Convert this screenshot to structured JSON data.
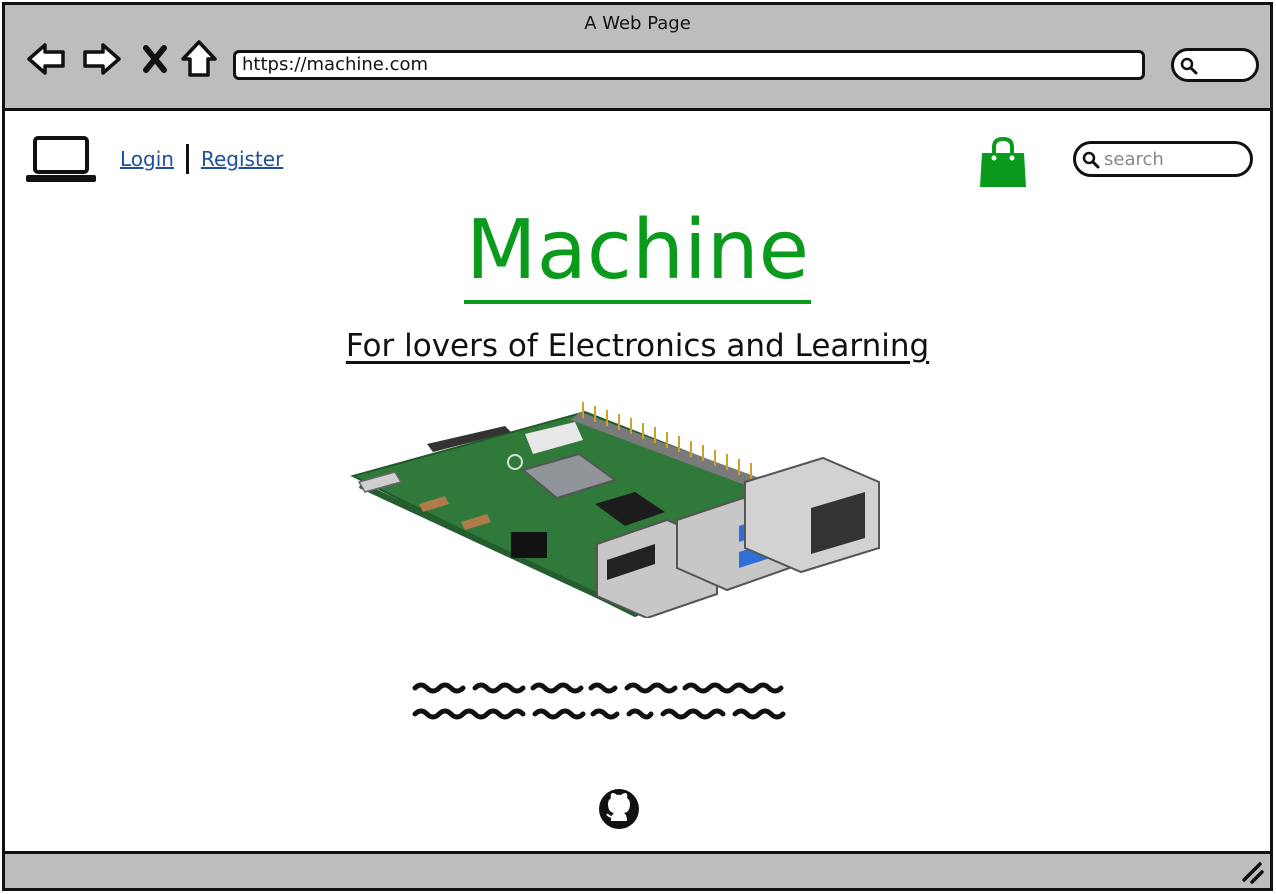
{
  "window": {
    "title": "A Web Page",
    "url": "https://machine.com"
  },
  "header": {
    "login_label": "Login",
    "register_label": "Register",
    "search_placeholder": "search"
  },
  "hero": {
    "title": "Machine",
    "tagline": "For lovers of Electronics and Learning"
  },
  "icons": {
    "back": "back-arrow-icon",
    "forward": "forward-arrow-icon",
    "stop": "close-icon",
    "home": "home-icon",
    "laptop": "laptop-icon",
    "bag": "shopping-bag-icon",
    "search": "search-icon",
    "github": "github-icon",
    "board": "raspberry-pi-board-image"
  },
  "colors": {
    "brand_green": "#0a9a1c",
    "link_blue": "#1f4fa0",
    "chrome_gray": "#bdbdbd"
  }
}
